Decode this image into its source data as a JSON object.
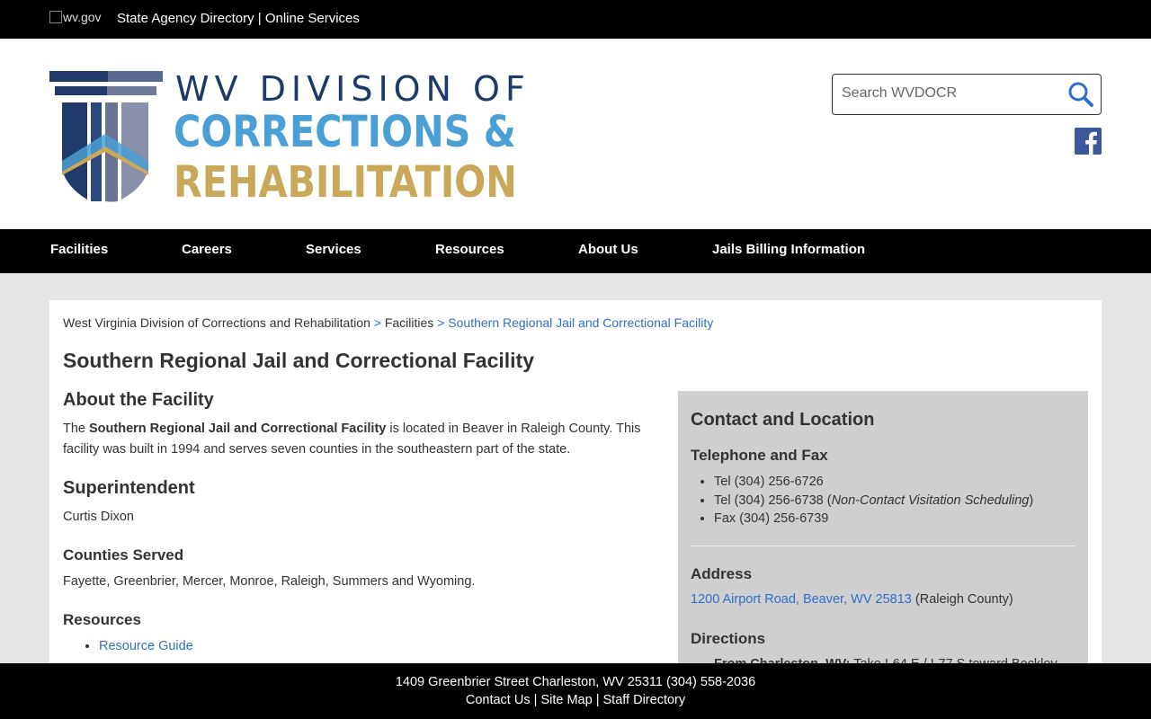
{
  "topbar": {
    "wv_logo_alt": "wv.gov",
    "directory_link": "State Agency Directory",
    "separator": "|",
    "online_services_link": "Online Services"
  },
  "logo": {
    "line1": "WV DIVISION OF",
    "line2": "CORRECTIONS &",
    "line3": "REHABILITATION",
    "colors": {
      "navy": "#1f3a68",
      "blue": "#4a9fd5",
      "gold": "#c9a85a"
    }
  },
  "search": {
    "placeholder": "Search WVDOCR",
    "icon": "search-icon"
  },
  "social": {
    "icon": "facebook-icon",
    "color": "#3b5998"
  },
  "nav": {
    "items": [
      "Facilities",
      "Careers",
      "Services",
      "Resources",
      "About Us",
      "Jails Billing Information"
    ]
  },
  "breadcrumb": {
    "home": "West Virginia Division of Corrections and Rehabilitation",
    "sep": ">",
    "facilities": "Facilities",
    "current": "Southern Regional Jail and Correctional Facility"
  },
  "page_title": "Southern Regional Jail and Correctional Facility",
  "about": {
    "heading": "About the Facility",
    "text_pre": "The ",
    "text_bold": "Southern Regional Jail and Correctional Facility",
    "text_post1": " is located in Beaver in Raleigh County. This",
    "text_post2": "facility was built in 1994 and serves seven counties in the southeastern part of the state."
  },
  "superintendent": {
    "heading": "Superintendent",
    "name": "Curtis Dixon"
  },
  "counties": {
    "heading": "Counties Served",
    "text": "Fayette, Greenbrier, Mercer, Monroe, Raleigh, Summers and Wyoming."
  },
  "resources": {
    "heading": "Resources",
    "items": [
      "Resource Guide"
    ]
  },
  "contact": {
    "heading": "Contact and Location",
    "phone_heading": "Telephone and Fax",
    "tel1": "Tel (304) 256-6726",
    "tel2_pre": "Tel (304) 256-6738 (",
    "tel2_italic": "Non-Contact Visitation Scheduling",
    "tel2_post": ")",
    "fax": "Fax (304) 256-6739",
    "address_heading": "Address",
    "address_link": "1200 Airport Road, Beaver, WV 25813",
    "address_county": " (Raleigh County)",
    "directions_heading": "Directions",
    "directions_bold": "From Charleston, WV:",
    "directions_text": " Take I-64 E / I-77 S toward Beckley"
  },
  "footer": {
    "address": "1409 Greenbrier Street Charleston, WV 25311 (304) 558-2036",
    "contact": "Contact Us",
    "sitemap": "Site Map",
    "staff": "Staff Directory",
    "sep": "|"
  }
}
